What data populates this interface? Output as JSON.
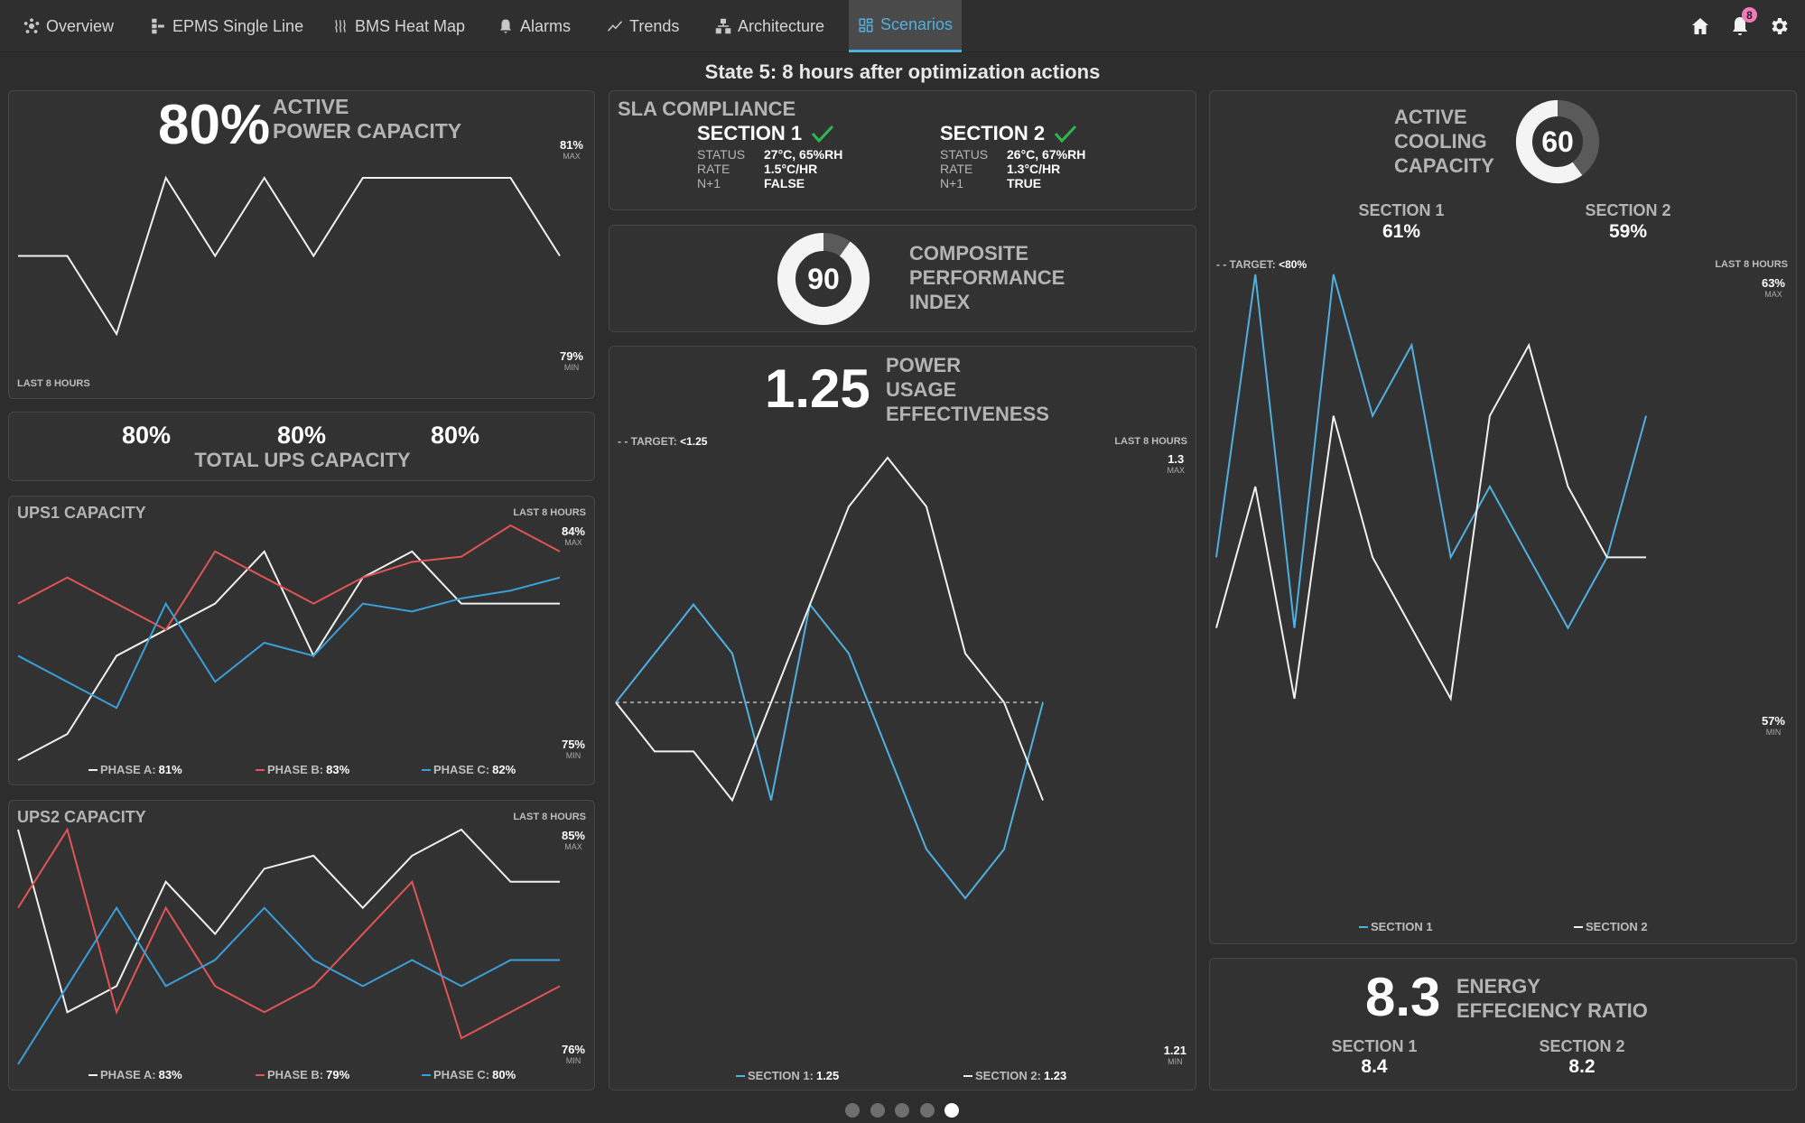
{
  "nav": {
    "tabs": [
      {
        "label": "Overview",
        "icon": "hub-icon"
      },
      {
        "label": "EPMS Single Line",
        "icon": "single-line-icon"
      },
      {
        "label": "BMS Heat Map",
        "icon": "heat-icon"
      },
      {
        "label": "Alarms",
        "icon": "bell-icon"
      },
      {
        "label": "Trends",
        "icon": "trend-icon"
      },
      {
        "label": "Architecture",
        "icon": "architecture-icon"
      },
      {
        "label": "Scenarios",
        "icon": "dashboard-icon",
        "active": true
      }
    ],
    "notification_count": "8",
    "accent_color": "#4fb0e0",
    "badge_color": "#ef7bb8"
  },
  "state_title": "State 5: 8 hours after optimization actions",
  "active_power": {
    "value": "80%",
    "label_line1": "ACTIVE",
    "label_line2": "POWER CAPACITY",
    "max_value": "81%",
    "max_label": "MAX",
    "min_value": "79%",
    "min_label": "MIN",
    "period": "LAST 8 HOURS"
  },
  "total_ups": {
    "values": [
      "80%",
      "80%",
      "80%"
    ],
    "label": "TOTAL UPS CAPACITY"
  },
  "ups1": {
    "title": "UPS1 CAPACITY",
    "period": "LAST 8 HOURS",
    "max_value": "84%",
    "max_label": "MAX",
    "min_value": "75%",
    "min_label": "MIN",
    "legend": [
      {
        "name": "PHASE A:",
        "value": "81%",
        "color": "#f0f0f0"
      },
      {
        "name": "PHASE B:",
        "value": "83%",
        "color": "#e05555"
      },
      {
        "name": "PHASE C:",
        "value": "82%",
        "color": "#3a9fd8"
      }
    ]
  },
  "ups2": {
    "title": "UPS2 CAPACITY",
    "period": "LAST 8 HOURS",
    "max_value": "85%",
    "max_label": "MAX",
    "min_value": "76%",
    "min_label": "MIN",
    "legend": [
      {
        "name": "PHASE A:",
        "value": "83%",
        "color": "#f0f0f0"
      },
      {
        "name": "PHASE B:",
        "value": "79%",
        "color": "#e05555"
      },
      {
        "name": "PHASE C:",
        "value": "80%",
        "color": "#3a9fd8"
      }
    ]
  },
  "sla": {
    "title": "SLA COMPLIANCE",
    "check_color": "#2eb84d",
    "sections": [
      {
        "name": "SECTION 1",
        "rows": [
          {
            "k": "STATUS",
            "v": "27°C, 65%RH"
          },
          {
            "k": "RATE",
            "v": "1.5°C/HR"
          },
          {
            "k": "N+1",
            "v": "FALSE"
          }
        ]
      },
      {
        "name": "SECTION 2",
        "rows": [
          {
            "k": "STATUS",
            "v": "26°C, 67%RH"
          },
          {
            "k": "RATE",
            "v": "1.3°C/HR"
          },
          {
            "k": "N+1",
            "v": "TRUE"
          }
        ]
      }
    ]
  },
  "cpi": {
    "value": "90",
    "fraction": 0.9,
    "label_lines": [
      "COMPOSITE",
      "PERFORMANCE",
      "INDEX"
    ]
  },
  "pue": {
    "value": "1.25",
    "label_lines": [
      "POWER",
      "USAGE",
      "EFFECTIVENESS"
    ],
    "target_prefix": "- - TARGET:",
    "target_value": "<1.25",
    "period": "LAST 8 HOURS",
    "max_value": "1.3",
    "max_label": "MAX",
    "min_value": "1.21",
    "min_label": "MIN",
    "legend": [
      {
        "name": "SECTION 1:",
        "value": "1.25",
        "color": "#4fb0e0"
      },
      {
        "name": "SECTION 2:",
        "value": "1.23",
        "color": "#f0f0f0"
      }
    ]
  },
  "cooling": {
    "value": "60",
    "fraction": 0.6,
    "label_lines": [
      "ACTIVE",
      "COOLING",
      "CAPACITY"
    ],
    "sections": [
      {
        "name": "SECTION 1",
        "value": "61%"
      },
      {
        "name": "SECTION 2",
        "value": "59%"
      }
    ],
    "target_prefix": "- - TARGET:",
    "target_value": "<80%",
    "period": "LAST 8 HOURS",
    "max_value": "63%",
    "max_label": "MAX",
    "min_value": "57%",
    "min_label": "MIN",
    "legend": [
      {
        "name": "SECTION 1",
        "color": "#4fb0e0"
      },
      {
        "name": "SECTION 2",
        "color": "#f0f0f0"
      }
    ]
  },
  "eer": {
    "value": "8.3",
    "label_line1": "ENERGY",
    "label_line2": "EFFECIENCY RATIO",
    "sections": [
      {
        "name": "SECTION 1",
        "value": "8.4"
      },
      {
        "name": "SECTION 2",
        "value": "8.2"
      }
    ]
  },
  "pagination": {
    "count": 5,
    "active": 5
  },
  "chart_data": [
    {
      "id": "active_power",
      "type": "line",
      "title": "ACTIVE POWER CAPACITY",
      "ylim": [
        79,
        81
      ],
      "x": [
        1,
        2,
        3,
        4,
        5,
        6,
        7,
        8,
        9,
        10,
        11,
        12
      ],
      "series": [
        {
          "name": "Active Power",
          "color": "#f0f0f0",
          "values": [
            80,
            80,
            79,
            81,
            80,
            81,
            80,
            81,
            81,
            81,
            81,
            80
          ]
        }
      ]
    },
    {
      "id": "ups1",
      "type": "line",
      "title": "UPS1 CAPACITY",
      "ylim": [
        75,
        84
      ],
      "x": [
        1,
        2,
        3,
        4,
        5,
        6,
        7,
        8,
        9,
        10,
        11,
        12
      ],
      "series": [
        {
          "name": "PHASE A",
          "color": "#f0f0f0",
          "values": [
            75,
            76,
            79,
            80,
            81,
            83,
            79,
            82,
            83,
            81,
            81,
            81
          ]
        },
        {
          "name": "PHASE B",
          "color": "#e05555",
          "values": [
            81,
            82,
            81,
            80,
            83,
            82,
            81,
            82,
            82.6,
            82.8,
            84,
            83
          ]
        },
        {
          "name": "PHASE C",
          "color": "#3a9fd8",
          "values": [
            79,
            78,
            77,
            81,
            78,
            79.5,
            79,
            81,
            80.7,
            81.2,
            81.5,
            82
          ]
        }
      ]
    },
    {
      "id": "ups2",
      "type": "line",
      "title": "UPS2 CAPACITY",
      "ylim": [
        76,
        85
      ],
      "x": [
        1,
        2,
        3,
        4,
        5,
        6,
        7,
        8,
        9,
        10,
        11,
        12
      ],
      "series": [
        {
          "name": "PHASE A",
          "color": "#f0f0f0",
          "values": [
            85,
            78,
            79,
            83,
            81,
            83.5,
            84,
            82,
            84,
            85,
            83,
            83
          ]
        },
        {
          "name": "PHASE B",
          "color": "#e05555",
          "values": [
            82,
            85,
            78,
            82,
            79,
            78,
            79,
            81,
            83,
            77,
            78,
            79
          ]
        },
        {
          "name": "PHASE C",
          "color": "#3a9fd8",
          "values": [
            76,
            79,
            82,
            79,
            80,
            82,
            80,
            79,
            80,
            79,
            80,
            80
          ]
        }
      ]
    },
    {
      "id": "pue",
      "type": "line",
      "title": "POWER USAGE EFFECTIVENESS",
      "ylim": [
        1.21,
        1.3
      ],
      "target": 1.25,
      "x": [
        1,
        2,
        3,
        4,
        5,
        6,
        7,
        8,
        9,
        10,
        11,
        12
      ],
      "series": [
        {
          "name": "SECTION 1",
          "color": "#4fb0e0",
          "values": [
            1.25,
            1.26,
            1.27,
            1.26,
            1.23,
            1.27,
            1.26,
            1.24,
            1.22,
            1.21,
            1.22,
            1.25
          ]
        },
        {
          "name": "SECTION 2",
          "color": "#f0f0f0",
          "values": [
            1.25,
            1.24,
            1.24,
            1.23,
            1.25,
            1.27,
            1.29,
            1.3,
            1.29,
            1.26,
            1.25,
            1.23
          ]
        }
      ]
    },
    {
      "id": "cooling",
      "type": "line",
      "title": "ACTIVE COOLING CAPACITY",
      "ylim": [
        57,
        63
      ],
      "x": [
        1,
        2,
        3,
        4,
        5,
        6,
        7,
        8,
        9,
        10,
        11,
        12
      ],
      "series": [
        {
          "name": "SECTION 1",
          "color": "#4fb0e0",
          "values": [
            59,
            63,
            58,
            63,
            61,
            62,
            59,
            60,
            59,
            58,
            59,
            61
          ]
        },
        {
          "name": "SECTION 2",
          "color": "#f0f0f0",
          "values": [
            58,
            60,
            57,
            61,
            59,
            58,
            57,
            61,
            62,
            60,
            59,
            59
          ]
        }
      ]
    }
  ]
}
